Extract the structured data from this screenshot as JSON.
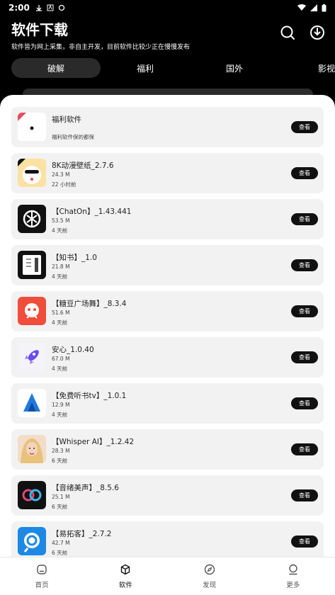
{
  "status_bar": {
    "time": "2:00"
  },
  "header": {
    "title": "软件下载",
    "subtitle": "软件皆为网上采集，非自主开发，目前软件比较少正在慢慢发布"
  },
  "tabs": [
    {
      "label": "破解",
      "active": true
    },
    {
      "label": "福利",
      "active": false
    },
    {
      "label": "国外",
      "active": false
    },
    {
      "label": "影视",
      "active": false
    }
  ],
  "apps": [
    {
      "name": "福利软件",
      "size": "",
      "time": "",
      "desc": "福利软件保的都保",
      "button": "查看",
      "icon": "welfare-icon"
    },
    {
      "name": "8K动漫壁纸_2.7.6",
      "size": "24.3 M",
      "time": "22 小时前",
      "desc": "",
      "button": "查看",
      "icon": "anime-wallpaper-icon"
    },
    {
      "name": "【ChatOn】_1.43.441",
      "size": "53.5 M",
      "time": "4 天前",
      "desc": "",
      "button": "查看",
      "icon": "chaton-icon"
    },
    {
      "name": "【知书】_1.0",
      "size": "21.8 M",
      "time": "4 天前",
      "desc": "",
      "button": "查看",
      "icon": "zhishu-icon"
    },
    {
      "name": "【糖豆广场舞】_8.3.4",
      "size": "51.6 M",
      "time": "4 天前",
      "desc": "",
      "button": "查看",
      "icon": "tangdou-icon"
    },
    {
      "name": "安心_1.0.40",
      "size": "67.0 M",
      "time": "4 天前",
      "desc": "",
      "button": "查看",
      "icon": "rocket-icon"
    },
    {
      "name": "【免费听书tv】_1.0.1",
      "size": "12.9 M",
      "time": "4 天前",
      "desc": "",
      "button": "查看",
      "icon": "audiobook-icon"
    },
    {
      "name": "【Whisper AI】_1.2.42",
      "size": "28.3 M",
      "time": "6 天前",
      "desc": "",
      "button": "查看",
      "icon": "whisper-ai-icon"
    },
    {
      "name": "【音绪美声】_8.5.6",
      "size": "25.1 M",
      "time": "6 天前",
      "desc": "",
      "button": "查看",
      "icon": "voice-icon"
    },
    {
      "name": "【易拓客】_2.7.2",
      "size": "42.7 M",
      "time": "6 天前",
      "desc": "",
      "button": "查看",
      "icon": "yituoke-icon"
    }
  ],
  "bottom_nav": [
    {
      "label": "首页",
      "icon": "home-icon",
      "active": false
    },
    {
      "label": "软件",
      "icon": "box-icon",
      "active": true
    },
    {
      "label": "发现",
      "icon": "compass-icon",
      "active": false
    },
    {
      "label": "更多",
      "icon": "user-icon",
      "active": false
    }
  ]
}
